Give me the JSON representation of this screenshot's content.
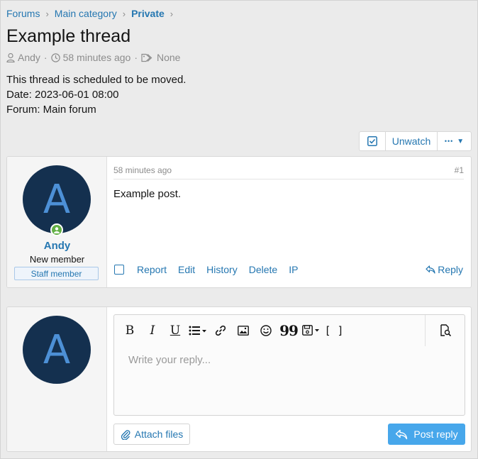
{
  "breadcrumb": {
    "items": [
      "Forums",
      "Main category",
      "Private"
    ]
  },
  "thread": {
    "title": "Example thread",
    "author": "Andy",
    "time": "58 minutes ago",
    "tags": "None",
    "notice_line1": "This thread is scheduled to be moved.",
    "notice_line2": "Date: 2023-06-01 08:00",
    "notice_line3": "Forum: Main forum"
  },
  "thread_buttons": {
    "check_icon": "checkbox-icon",
    "unwatch": "Unwatch",
    "more": "•••"
  },
  "post": {
    "avatar_letter": "A",
    "username": "Andy",
    "user_title": "New member",
    "banner": "Staff member",
    "date": "58 minutes ago",
    "number": "#1",
    "body": "Example post.",
    "actions": [
      "Report",
      "Edit",
      "History",
      "Delete",
      "IP"
    ],
    "reply": "Reply"
  },
  "reply_form": {
    "avatar_letter": "A",
    "placeholder": "Write your reply...",
    "attach": "Attach files",
    "submit": "Post reply",
    "toolbar": {
      "bold": "B",
      "italic": "I",
      "underline": "U",
      "list_icon": "list-icon",
      "link_icon": "link-icon",
      "image_icon": "image-icon",
      "smilie_icon": "smilie-icon",
      "quote": "99",
      "drafts_icon": "save-icon",
      "code": "[ ]",
      "preview_icon": "preview-icon"
    }
  },
  "colors": {
    "link": "#2577b1",
    "avatar_bg": "#14304f",
    "avatar_letter": "#4d90d6",
    "online": "#63b045",
    "primary_button": "#47a7eb"
  }
}
